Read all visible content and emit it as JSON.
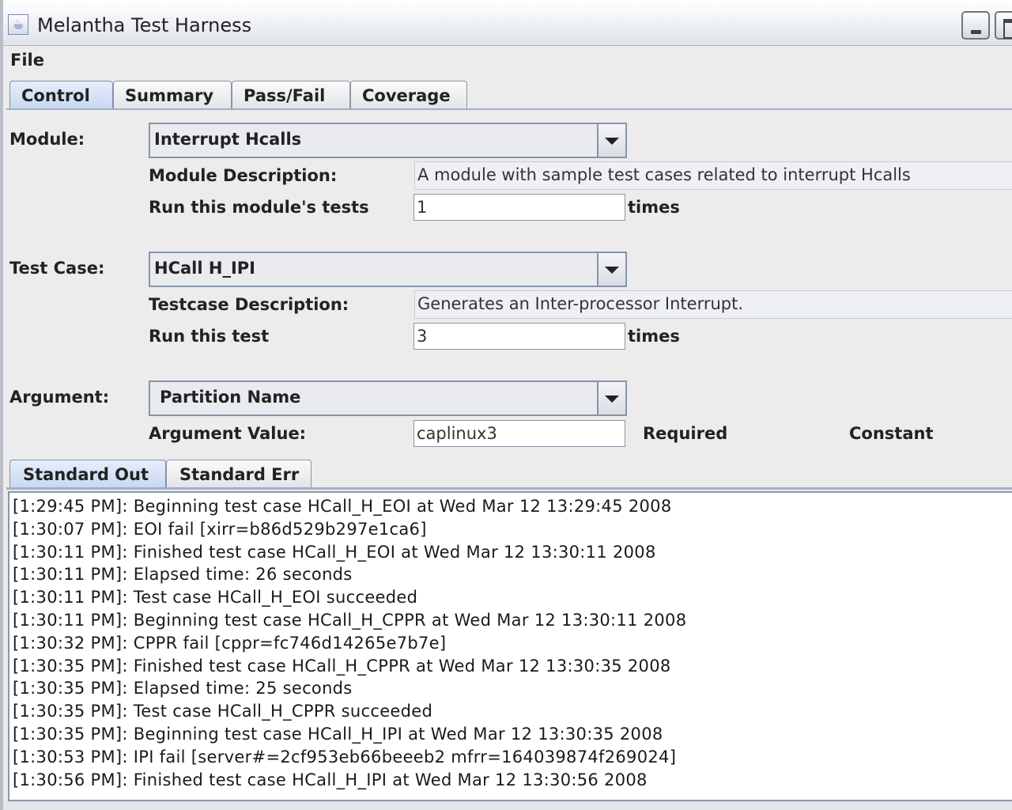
{
  "window": {
    "title": "Melantha Test Harness"
  },
  "menu": {
    "file": "File"
  },
  "tabs": [
    {
      "label": "Control"
    },
    {
      "label": "Summary"
    },
    {
      "label": "Pass/Fail"
    },
    {
      "label": "Coverage"
    }
  ],
  "control": {
    "module_label": "Module:",
    "module_value": "Interrupt Hcalls",
    "module_desc_label": "Module Description:",
    "module_desc": "A module with sample test cases related to interrupt Hcalls",
    "module_run_label": "Run this module's tests",
    "module_run_count": "1",
    "module_times": "times",
    "testcase_label": "Test Case:",
    "testcase_value": "HCall H_IPI",
    "testcase_desc_label": "Testcase Description:",
    "testcase_desc": "Generates an Inter-processor Interrupt.",
    "test_run_label": "Run this test",
    "test_run_count": "3",
    "test_times": "times",
    "argument_label": "Argument:",
    "argument_value": "Partition Name",
    "argument_value_label": "Argument Value:",
    "argument_input": "caplinux3",
    "required": "Required",
    "constant": "Constant"
  },
  "output_tabs": [
    {
      "label": "Standard Out"
    },
    {
      "label": "Standard Err"
    }
  ],
  "console_lines": [
    "[1:29:45 PM]: Beginning test case HCall_H_EOI at Wed Mar 12 13:29:45 2008",
    "[1:30:07 PM]: EOI fail [xirr=b86d529b297e1ca6]",
    "[1:30:11 PM]: Finished test case HCall_H_EOI at Wed Mar 12 13:30:11 2008",
    "[1:30:11 PM]: Elapsed time: 26 seconds",
    "[1:30:11 PM]: Test case HCall_H_EOI succeeded",
    "[1:30:11 PM]: Beginning test case HCall_H_CPPR at Wed Mar 12 13:30:11 2008",
    "[1:30:32 PM]: CPPR fail [cppr=fc746d14265e7b7e]",
    "[1:30:35 PM]: Finished test case HCall_H_CPPR at Wed Mar 12 13:30:35 2008",
    "[1:30:35 PM]: Elapsed time: 25 seconds",
    "[1:30:35 PM]: Test case HCall_H_CPPR succeeded",
    "[1:30:35 PM]: Beginning test case HCall_H_IPI at Wed Mar 12 13:30:35 2008",
    "[1:30:53 PM]: IPI fail [server#=2cf953eb66beeeb2 mfrr=164039874f269024]",
    "[1:30:56 PM]: Finished test case HCall_H_IPI at Wed Mar 12 13:30:56 2008"
  ]
}
